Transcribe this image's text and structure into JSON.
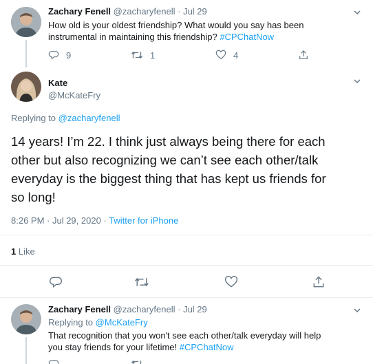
{
  "top_tweet": {
    "name": "Zachary Fenell",
    "handle": "@zacharyfenell",
    "sep": "·",
    "date": "Jul 29",
    "text_line1": "How old is your oldest friendship? What would you say has been",
    "text_line2": "instrumental in maintaining this friendship?",
    "hashtag": "#CPChatNow",
    "reply_count": "9",
    "retweet_count": "1",
    "like_count": "4"
  },
  "main_tweet": {
    "name": "Kate",
    "handle": "@McKateFry",
    "replying_prefix": "Replying to",
    "replying_to": "@zacharyfenell",
    "text_line1": "14 years! I’m 22. I think just always being there for each",
    "text_line2": "other but also recognizing we can’t see each other/talk",
    "text_line3": "everyday is the biggest thing that has kept us friends for",
    "text_line4": "so long!",
    "time": "8:26 PM · Jul 29, 2020 ·",
    "source": "Twitter for iPhone",
    "likes_count": "1",
    "likes_label": "Like"
  },
  "reply_tweet": {
    "name": "Zachary Fenell",
    "handle": "@zacharyfenell",
    "sep": "·",
    "date": "Jul 29",
    "replying_prefix": "Replying to",
    "replying_to": "@McKateFry",
    "text_line1": "That recognition that you won't see each other/talk everyday will help",
    "text_line2": "you stay friends for your lifetime!",
    "hashtag": "#CPChatNow"
  },
  "colors": {
    "accent": "#1da1f2",
    "muted": "#657786",
    "text": "#14171a",
    "border": "#e6ecf0"
  },
  "icons": [
    "reply-icon",
    "retweet-icon",
    "like-icon",
    "share-icon",
    "chevron-down-icon"
  ]
}
